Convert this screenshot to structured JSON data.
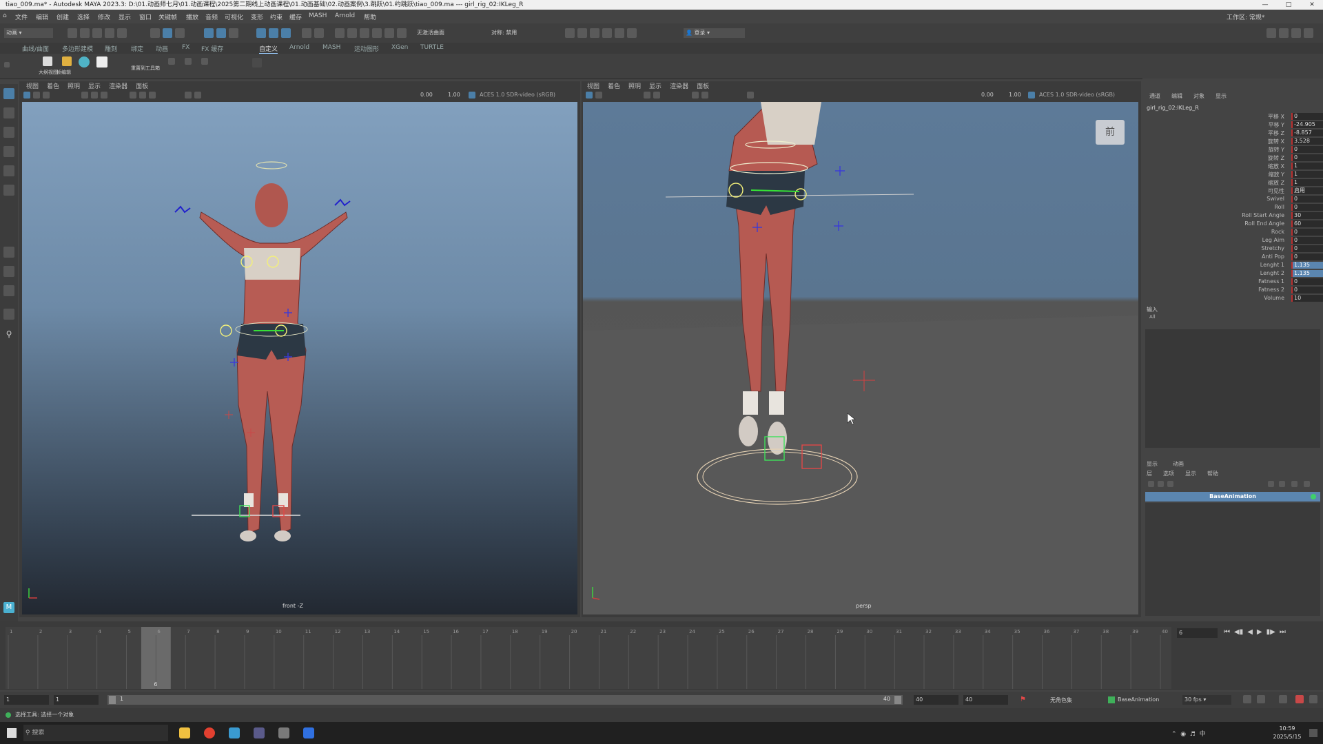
{
  "window": {
    "title": "tiao_009.ma* - Autodesk MAYA 2023.3: D:\\01.动画师七月\\01.动画课程\\2025第二期线上动画课程\\01.动画基础\\02.动画案例\\3.跳跃\\01.约跳跃\\tiao_009.ma  ---  girl_rig_02:IKLeg_R"
  },
  "menubar": {
    "items": [
      "文件",
      "编辑",
      "创建",
      "选择",
      "修改",
      "显示",
      "窗口",
      "关键帧",
      "播放",
      "音频",
      "可视化",
      "变形",
      "约束",
      "缓存",
      "MASH",
      "Arnold",
      "帮助"
    ],
    "workspace_label": "工作区: 常规*",
    "mode_select": "动画"
  },
  "toolbar": {
    "dropdown_surfaces": "无激活曲面",
    "dropdown_symmetry": "对称: 禁用",
    "login": "登录"
  },
  "shelf": {
    "tabs": [
      "曲线/曲面",
      "多边形建模",
      "雕刻",
      "绑定",
      "动画",
      "FX",
      "FX 缓存",
      "自定义",
      "Arnold",
      "MASH",
      "运动图形",
      "XGen",
      "TURTLE"
    ],
    "active_tab": "自定义",
    "buttons": [
      "大纲视图",
      "帧编辑",
      "重置到工具箱"
    ]
  },
  "viewport_left": {
    "menus": [
      "视图",
      "着色",
      "照明",
      "显示",
      "渲染器",
      "面板"
    ],
    "exposure": "0.00",
    "gamma": "1.00",
    "colorspace": "ACES 1.0 SDR-video (sRGB)",
    "camera": "front -Z"
  },
  "viewport_right": {
    "menus": [
      "视图",
      "着色",
      "照明",
      "显示",
      "渲染器",
      "面板"
    ],
    "exposure": "0.00",
    "gamma": "1.00",
    "colorspace": "ACES 1.0 SDR-video (sRGB)",
    "camera": "persp",
    "viewcube": "前"
  },
  "channel_box": {
    "tabs": [
      "通道",
      "编辑",
      "对象",
      "显示"
    ],
    "node": "girl_rig_02:IKLeg_R",
    "attributes": [
      {
        "name": "平移 X",
        "value": "0"
      },
      {
        "name": "平移 Y",
        "value": "-24.905"
      },
      {
        "name": "平移 Z",
        "value": "-8.857"
      },
      {
        "name": "旋转 X",
        "value": "3.528"
      },
      {
        "name": "旋转 Y",
        "value": "0"
      },
      {
        "name": "旋转 Z",
        "value": "0"
      },
      {
        "name": "缩放 X",
        "value": "1"
      },
      {
        "name": "缩放 Y",
        "value": "1"
      },
      {
        "name": "缩放 Z",
        "value": "1"
      },
      {
        "name": "可见性",
        "value": "启用"
      },
      {
        "name": "Swivel",
        "value": "0"
      },
      {
        "name": "Roll",
        "value": "0"
      },
      {
        "name": "Roll Start Angle",
        "value": "30"
      },
      {
        "name": "Roll End Angle",
        "value": "60"
      },
      {
        "name": "Rock",
        "value": "0"
      },
      {
        "name": "Leg Aim",
        "value": "0"
      },
      {
        "name": "Stretchy",
        "value": "0"
      },
      {
        "name": "Anti Pop",
        "value": "0"
      },
      {
        "name": "Lenght 1",
        "value": "1.135",
        "highlight": true
      },
      {
        "name": "Lenght 2",
        "value": "1.135",
        "highlight": true
      },
      {
        "name": "Fatness 1",
        "value": "0"
      },
      {
        "name": "Fatness 2",
        "value": "0"
      },
      {
        "name": "Volume",
        "value": "10"
      }
    ],
    "inputs_label": "输入",
    "inputs_value": "All"
  },
  "layer_editor": {
    "tabs": [
      "显示",
      "动画"
    ],
    "menus": [
      "层",
      "选项",
      "显示",
      "帮助"
    ],
    "layer_name": "BaseAnimation",
    "layer_color": "#5b86b0"
  },
  "timeline": {
    "frames": [
      "1",
      "2",
      "3",
      "4",
      "5",
      "6",
      "7",
      "8",
      "9",
      "10",
      "11",
      "12",
      "13",
      "14",
      "15",
      "16",
      "17",
      "18",
      "19",
      "20",
      "21",
      "22",
      "23",
      "24",
      "25",
      "26",
      "27",
      "28",
      "29",
      "30",
      "31",
      "32",
      "33",
      "34",
      "35",
      "36",
      "37",
      "38",
      "39",
      "40"
    ],
    "current_frame": "6",
    "current_frame_field": "6"
  },
  "range": {
    "start": "1",
    "start_inner": "1",
    "range_start_label": "1",
    "range_end_label": "40",
    "end_inner": "40",
    "end": "40",
    "char_set": "无角色集",
    "anim_layer": "BaseAnimation",
    "fps": "30 fps"
  },
  "status": {
    "message": "选择工具: 选择一个对象"
  },
  "taskbar": {
    "search": "搜索",
    "time": "10:59",
    "date": "2025/5/15",
    "ime": "中"
  }
}
